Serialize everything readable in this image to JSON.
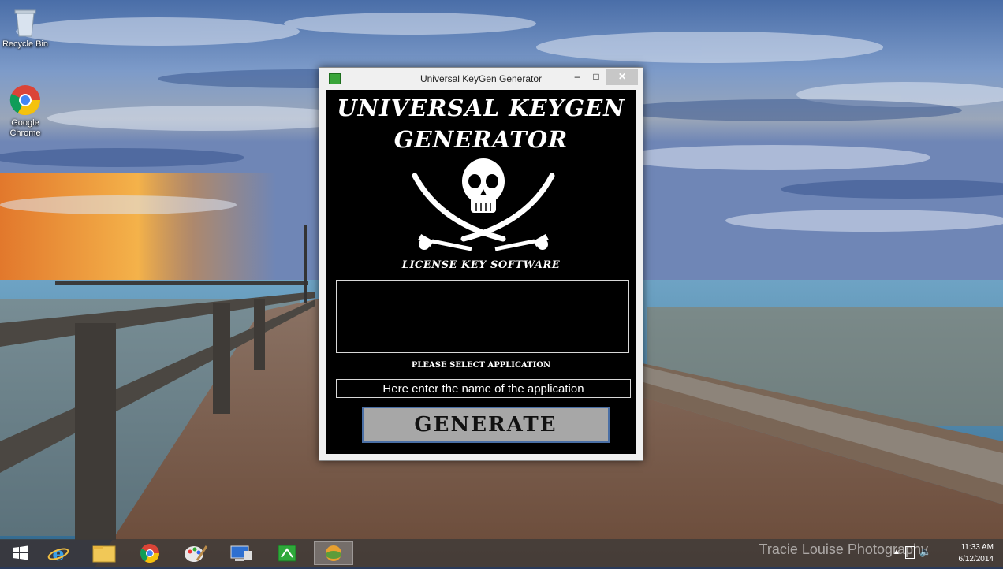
{
  "desktop": {
    "icons": [
      {
        "label": "Recycle Bin",
        "icon": "recycle-bin-icon"
      },
      {
        "label": "Google Chrome",
        "icon": "chrome-icon"
      }
    ]
  },
  "window": {
    "title": "Universal KeyGen Generator",
    "heading_line1": "UNIVERSAL KEYGEN",
    "heading_line2": "GENERATOR",
    "emblem": "jolly-roger-icon",
    "subtitle": "LICENSE KEY SOFTWARE",
    "output_value": "",
    "select_label": "PLEASE SELECT APPLICATION",
    "app_input_placeholder": "Here enter the name of the application",
    "generate_label": "GENERATE",
    "controls": {
      "minimize": "–",
      "maximize": "□",
      "close": "✕"
    }
  },
  "taskbar": {
    "items": [
      "start-icon",
      "internet-explorer-icon",
      "file-explorer-icon",
      "chrome-icon",
      "paint-icon",
      "remote-desktop-icon",
      "keygen-app-icon",
      "app-icon"
    ],
    "watermark": "Tracie Louise Photography",
    "clock_time": "11:33 AM",
    "clock_date": "6/12/2014"
  },
  "colors": {
    "window_bg": "#000000",
    "button_bg": "#a7a7a7",
    "button_border": "#4a6fa5"
  }
}
